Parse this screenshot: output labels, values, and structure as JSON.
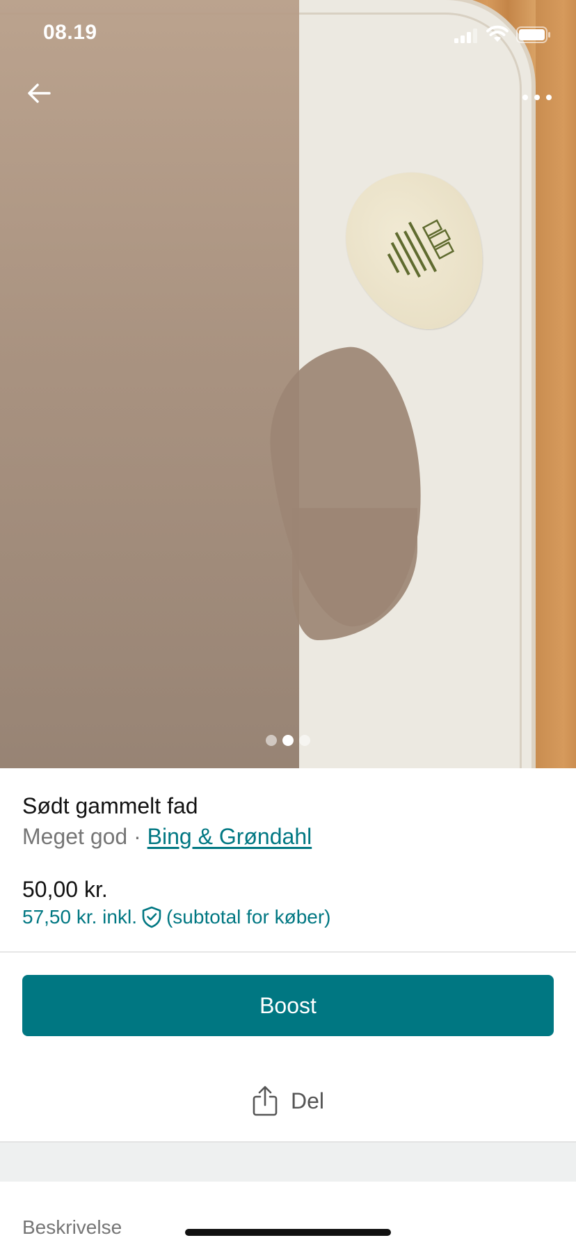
{
  "status_bar": {
    "time": "08.19"
  },
  "photo": {
    "image_count": 3,
    "active_index": 1
  },
  "navigation": {
    "back_icon": "arrow-left-icon",
    "more_icon": "more-horizontal-icon"
  },
  "item": {
    "title": "Sødt gammelt fad",
    "condition": "Meget god",
    "separator": " · ",
    "brand": "Bing & Grøndahl",
    "price": "50,00 kr.",
    "price_incl": "57,50 kr. inkl.",
    "price_incl_note": "(subtotal for køber)",
    "protection_icon": "shield-check-icon"
  },
  "actions": {
    "boost_label": "Boost",
    "share_label": "Del",
    "share_icon": "share-icon"
  },
  "sections": {
    "description_label": "Beskrivelse"
  },
  "colors": {
    "accent": "#007782",
    "muted_text": "#757575"
  }
}
